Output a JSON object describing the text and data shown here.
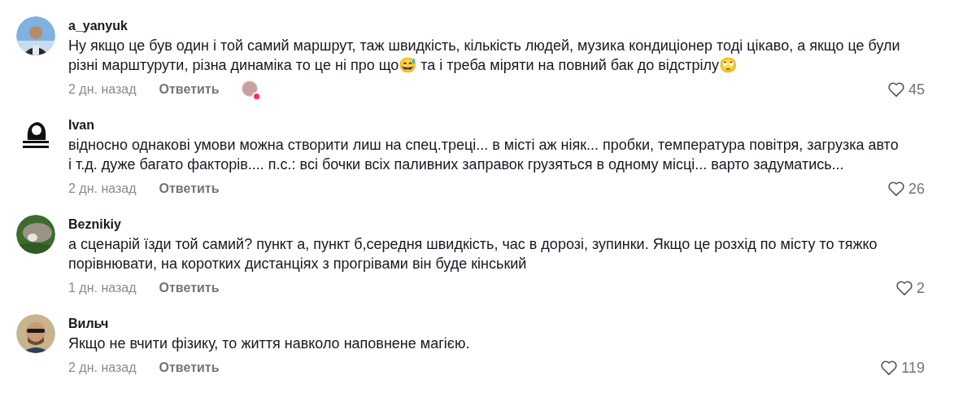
{
  "comments": [
    {
      "author": "a_yanyuk",
      "text": "Ну якщо це був один і той самий маршрут, таж швидкість, кількість людей, музика кондиціонер тоді цікаво, а якщо це були різні марштурути, різна динаміка то це ні про що😅 та і треба міряти на повний бак до відстрілу🙄",
      "time": "2 дн. назад",
      "reply": "Ответить",
      "liked_by_creator": true,
      "likes": "45"
    },
    {
      "author": "Ivan",
      "text": "відносно однакові умови можна створити лиш на спец.треці... в місті аж ніяк... пробки, температура повітря, загрузка авто і т.д. дуже багато факторів.... п.с.: всі бочки всіх паливних заправок грузяться в одному місці... варто задуматись...",
      "time": "2 дн. назад",
      "reply": "Ответить",
      "liked_by_creator": false,
      "likes": "26"
    },
    {
      "author": "Beznikiy",
      "text": "а сценарій їзди той самий? пункт а, пункт б,середня швидкість, час в дорозі, зупинки. Якщо це розхід по місту то тяжко порівнювати, на коротких дистанціях з прогрівами він буде кінський",
      "time": "1 дн. назад",
      "reply": "Ответить",
      "liked_by_creator": false,
      "likes": "2"
    },
    {
      "author": "Вильч",
      "text": "Якщо не вчити фізику, то життя навколо наповнене магією.",
      "time": "2 дн. назад",
      "reply": "Ответить",
      "liked_by_creator": false,
      "likes": "119"
    }
  ]
}
